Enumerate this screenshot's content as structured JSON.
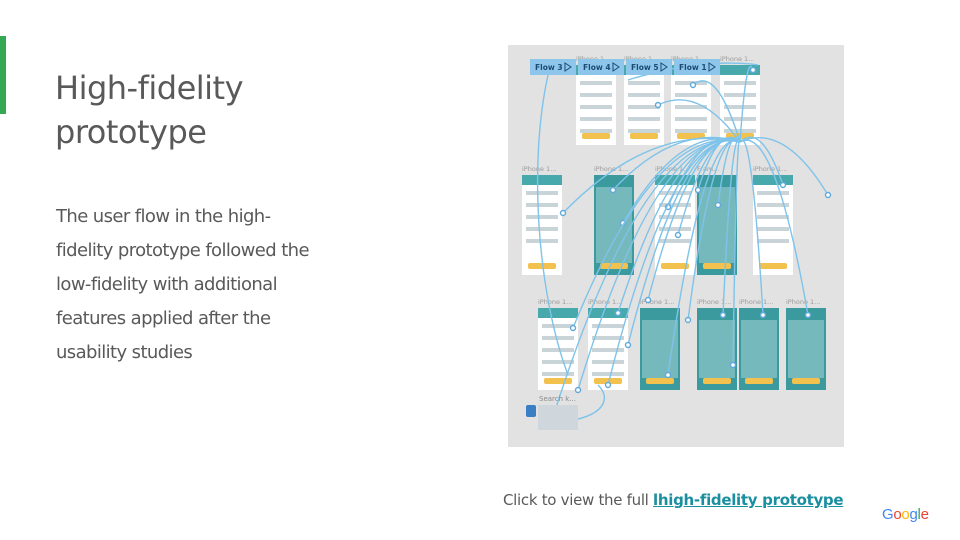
{
  "slide": {
    "title": "High-fidelity prototype",
    "body": "The user flow in the high-fidelity prototype followed the low-fidelity with additional features applied after the usability studies",
    "footer_prefix": "Click to view the full ",
    "footer_link_prefix": "l",
    "footer_link": "high-fidelity prototype",
    "accent_color": "#34a853",
    "link_color": "#1a8fa0",
    "text_color": "#595959"
  },
  "prototype": {
    "flows": [
      "Flow 3",
      "Flow 4",
      "Flow 5",
      "Flow 1"
    ],
    "frame_label": "iPhone 1...",
    "frame_label_alt": "Fram...",
    "keyboard_label": "Search k..."
  },
  "logo": {
    "letters": [
      "G",
      "o",
      "o",
      "g",
      "l",
      "e"
    ],
    "colors": [
      "#4285f4",
      "#ea4335",
      "#fbbc05",
      "#4285f4",
      "#34a853",
      "#ea4335"
    ]
  }
}
